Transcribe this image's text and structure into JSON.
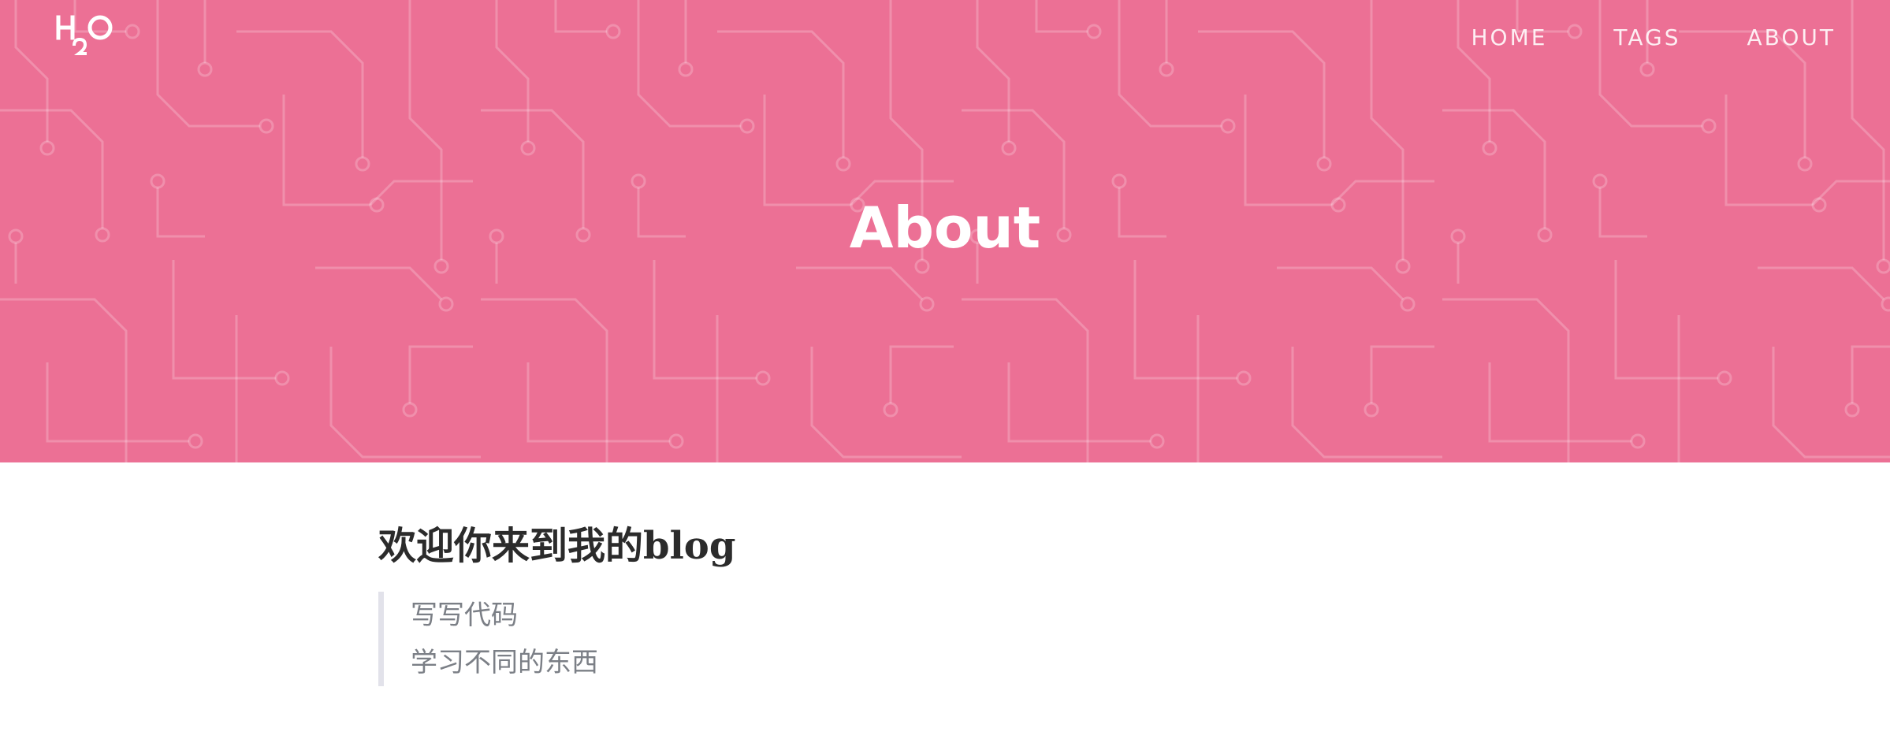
{
  "header": {
    "logo_text": "H2O",
    "nav": [
      {
        "label": "HOME"
      },
      {
        "label": "TAGS"
      },
      {
        "label": "ABOUT"
      }
    ],
    "title": "About",
    "background_color": "#ec7095"
  },
  "content": {
    "heading": "欢迎你来到我的blog",
    "quote_lines": [
      "写写代码",
      "学习不同的东西"
    ]
  }
}
